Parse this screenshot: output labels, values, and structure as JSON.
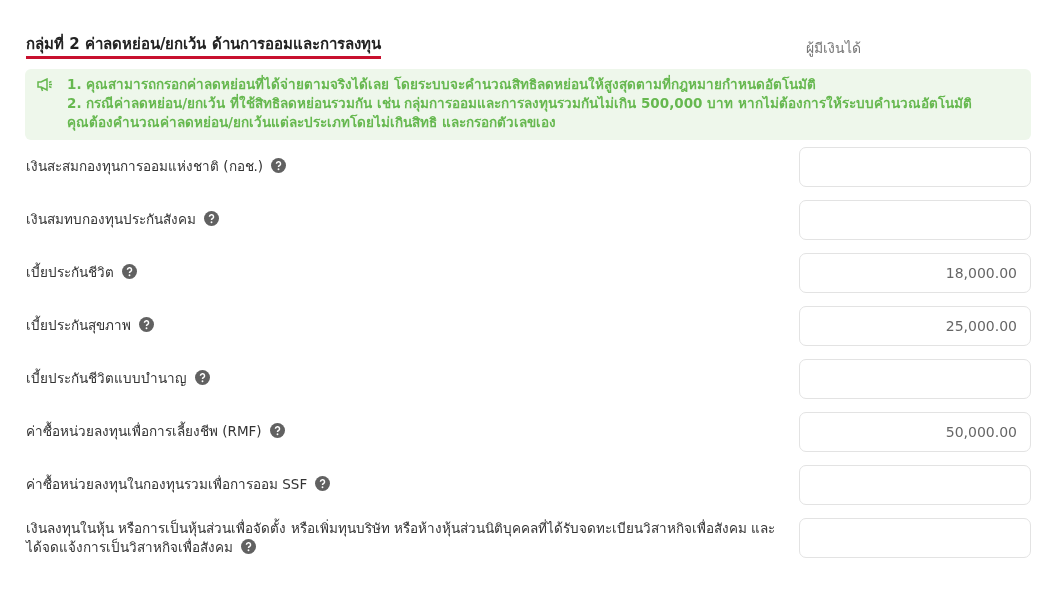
{
  "section": {
    "title": "กลุ่มที่ 2 ค่าลดหย่อน/ยกเว้น ด้านการออมและการลงทุน",
    "column_label": "ผู้มีเงินได้"
  },
  "notice": {
    "lines": [
      "1. คุณสามารถกรอกค่าลดหย่อนที่ได้จ่ายตามจริงได้เลย โดยระบบจะคำนวณสิทธิลดหย่อนให้สูงสุดตามที่กฎหมายกำหนดอัตโนมัติ",
      "2. กรณีค่าลดหย่อน/ยกเว้น ที่ใช้สิทธิลดหย่อนรวมกัน เช่น กลุ่มการออมและการลงทุนรวมกันไม่เกิน 500,000 บาท หากไม่ต้องการให้ระบบคำนวณอัตโนมัติ คุณต้องคำนวณค่าลดหย่อน/ยกเว้นแต่ละประเภทโดยไม่เกินสิทธิ และกรอกตัวเลขเอง"
    ]
  },
  "fields": [
    {
      "label": "เงินสะสมกองทุนการออมแห่งชาติ (กอช.)"
    },
    {
      "label": "เงินสมทบกองทุนประกันสังคม"
    },
    {
      "label": "เบี้ยประกันชีวิต",
      "value": "18,000.00"
    },
    {
      "label": "เบี้ยประกันสุขภาพ",
      "value": "25,000.00"
    },
    {
      "label": "เบี้ยประกันชีวิตแบบบำนาญ"
    },
    {
      "label": "ค่าซื้อหน่วยลงทุนเพื่อการเลี้ยงชีพ (RMF)",
      "value": "50,000.00"
    },
    {
      "label": "ค่าซื้อหน่วยลงทุนในกองทุนรวมเพื่อการออม SSF"
    },
    {
      "label": "เงินลงทุนในหุ้น หรือการเป็นหุ้นส่วนเพื่อจัดตั้ง หรือเพิ่มทุนบริษัท หรือห้างหุ้นส่วนนิติบุคคลที่ได้รับจดทะเบียนวิสาหกิจเพื่อสังคม และได้จดแจ้งการเป็นวิสาหกิจเพื่อสังคม"
    }
  ]
}
